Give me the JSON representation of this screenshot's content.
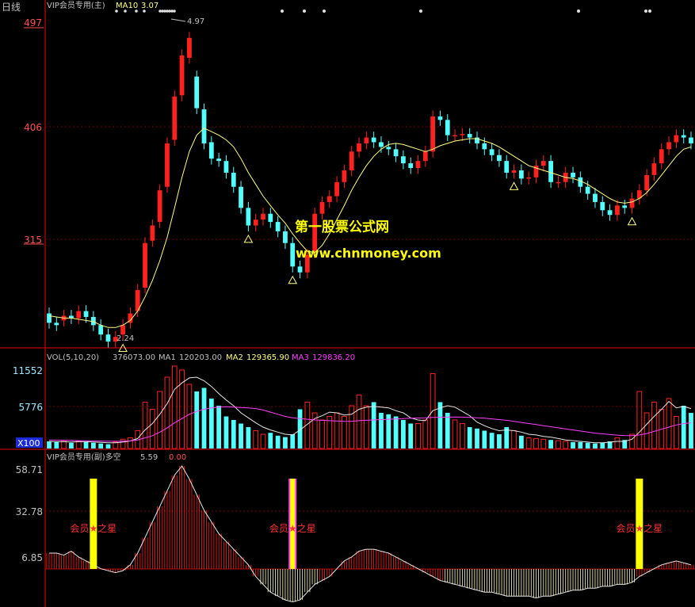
{
  "header": {
    "period": "日线",
    "indicator_main": "VIP会员专用(主)",
    "ma_label": "MA10",
    "ma_value": "3.07"
  },
  "watermark": {
    "site_name": "第一股票公式网",
    "site_url": "www.chnmoney.com"
  },
  "colors": {
    "background": "#000000",
    "frame": "#a00000",
    "up_candle": "#ff2020",
    "down_candle": "#54ffff",
    "ma_line": "#ffff80",
    "text_grey": "#c0c0c0",
    "axis_red": "#ff5050",
    "axis_cyan": "#9fe8ff",
    "magenta": "#ff40ff",
    "yellow": "#ffff00",
    "watermark_yellow": "#ffff00",
    "watermark_white": "#ffffff"
  },
  "chart_data": [
    {
      "type": "candlestick",
      "name": "price",
      "y_ticks": [
        "497",
        "406",
        "315"
      ],
      "y_tick_values": [
        4.97,
        4.06,
        3.15
      ],
      "ylim": [
        2.24,
        4.97
      ],
      "annotations": {
        "high_label": "4.97",
        "low_label": "2.24"
      },
      "grid": true,
      "closes": [
        2.42,
        2.4,
        2.48,
        2.46,
        2.52,
        2.47,
        2.4,
        2.32,
        2.26,
        2.3,
        2.4,
        2.5,
        2.7,
        3.1,
        3.25,
        3.55,
        3.95,
        4.35,
        4.7,
        4.85,
        4.25,
        3.95,
        3.82,
        3.8,
        3.7,
        3.58,
        3.4,
        3.25,
        3.3,
        3.35,
        3.28,
        3.2,
        3.1,
        2.9,
        2.85,
        3.0,
        3.35,
        3.45,
        3.5,
        3.62,
        3.72,
        3.88,
        3.95,
        4.0,
        3.96,
        3.92,
        3.9,
        3.84,
        3.78,
        3.74,
        3.8,
        3.88,
        4.18,
        4.15,
        4.02,
        4.02,
        4.03,
        4.0,
        3.95,
        3.9,
        3.85,
        3.8,
        3.7,
        3.72,
        3.65,
        3.66,
        3.76,
        3.8,
        3.62,
        3.62,
        3.7,
        3.66,
        3.58,
        3.52,
        3.45,
        3.38,
        3.34,
        3.42,
        3.4,
        3.48,
        3.55,
        3.68,
        3.78,
        3.9,
        3.96,
        4.02,
        4.0,
        3.95
      ],
      "opens": [
        2.5,
        2.42,
        2.44,
        2.48,
        2.46,
        2.52,
        2.47,
        2.4,
        2.32,
        2.26,
        2.32,
        2.42,
        2.52,
        2.72,
        3.12,
        3.28,
        3.58,
        3.98,
        4.36,
        4.68,
        4.52,
        4.24,
        3.96,
        3.82,
        3.8,
        3.7,
        3.58,
        3.4,
        3.25,
        3.3,
        3.35,
        3.28,
        3.2,
        3.1,
        2.9,
        2.85,
        3.02,
        3.35,
        3.45,
        3.5,
        3.62,
        3.72,
        3.88,
        3.95,
        4.0,
        3.96,
        3.92,
        3.9,
        3.84,
        3.78,
        3.74,
        3.8,
        3.88,
        4.18,
        4.15,
        4.02,
        4.02,
        4.03,
        4.0,
        3.95,
        3.9,
        3.85,
        3.8,
        3.7,
        3.72,
        3.65,
        3.66,
        3.76,
        3.8,
        3.62,
        3.62,
        3.7,
        3.66,
        3.58,
        3.52,
        3.45,
        3.38,
        3.34,
        3.42,
        3.4,
        3.48,
        3.55,
        3.68,
        3.78,
        3.9,
        3.96,
        4.02,
        4.0
      ],
      "ma10": [
        2.48,
        2.47,
        2.46,
        2.46,
        2.45,
        2.44,
        2.43,
        2.4,
        2.38,
        2.38,
        2.4,
        2.44,
        2.52,
        2.64,
        2.78,
        2.95,
        3.15,
        3.4,
        3.66,
        3.88,
        4.02,
        4.08,
        4.05,
        4.02,
        3.98,
        3.92,
        3.82,
        3.7,
        3.6,
        3.5,
        3.42,
        3.34,
        3.27,
        3.18,
        3.1,
        3.03,
        3.02,
        3.08,
        3.18,
        3.3,
        3.42,
        3.55,
        3.66,
        3.76,
        3.84,
        3.9,
        3.94,
        3.95,
        3.94,
        3.92,
        3.9,
        3.88,
        3.9,
        3.93,
        3.95,
        3.97,
        3.98,
        3.99,
        3.99,
        3.97,
        3.95,
        3.92,
        3.88,
        3.84,
        3.8,
        3.76,
        3.74,
        3.72,
        3.7,
        3.68,
        3.66,
        3.65,
        3.63,
        3.6,
        3.56,
        3.52,
        3.48,
        3.45,
        3.44,
        3.45,
        3.48,
        3.53,
        3.6,
        3.68,
        3.76,
        3.84,
        3.9,
        3.92
      ],
      "signal_marks": [
        10,
        27,
        33,
        63,
        79
      ]
    },
    {
      "type": "bar",
      "name": "volume",
      "header": "VOL(5,10,20)",
      "vol_value": "376073.00",
      "ma1_label": "MA1",
      "ma1_value": "120203.00",
      "ma2_label": "MA2",
      "ma2_value": "129365.90",
      "ma3_label": "MA3",
      "ma3_value": "129836.20",
      "y_ticks": [
        "11552",
        "5776"
      ],
      "y_tick_values": [
        11552,
        5776
      ],
      "unit_label": "X100",
      "ylim": [
        0,
        11552
      ],
      "values": [
        1000,
        900,
        1100,
        800,
        1000,
        900,
        800,
        700,
        600,
        900,
        1300,
        1500,
        2500,
        6500,
        5500,
        8000,
        10000,
        11552,
        11000,
        9000,
        8000,
        8500,
        7000,
        6000,
        4500,
        4000,
        3500,
        3000,
        2500,
        2000,
        2200,
        1800,
        1600,
        2000,
        5500,
        6500,
        5000,
        4000,
        4500,
        5000,
        4500,
        6000,
        7500,
        6000,
        6500,
        5000,
        4800,
        4500,
        4000,
        3500,
        3500,
        4000,
        10500,
        6500,
        5000,
        4000,
        3500,
        3000,
        2800,
        2500,
        2200,
        2000,
        3000,
        2500,
        1800,
        1500,
        1400,
        1300,
        1200,
        1100,
        1000,
        900,
        900,
        800,
        700,
        800,
        1000,
        1500,
        1200,
        2000,
        8000,
        5000,
        6500,
        5500,
        7000,
        4500,
        6000,
        5000
      ],
      "ma1": [
        1000,
        950,
        950,
        900,
        950,
        950,
        900,
        850,
        800,
        800,
        900,
        1050,
        1400,
        2600,
        3500,
        4800,
        6300,
        8300,
        9200,
        9900,
        10000,
        9500,
        8700,
        7700,
        6800,
        6000,
        5000,
        4300,
        3600,
        3000,
        2600,
        2300,
        2000,
        1900,
        2600,
        3400,
        4200,
        4600,
        5100,
        5000,
        4700,
        4800,
        5500,
        5800,
        5900,
        5800,
        5700,
        5300,
        5000,
        4300,
        4000,
        3900,
        5300,
        5700,
        6000,
        5800,
        5200,
        4600,
        3700,
        3200,
        2800,
        2500,
        2600,
        2500,
        2300,
        2000,
        1900,
        1700,
        1600,
        1400,
        1200,
        1100,
        1000,
        900,
        800,
        800,
        900,
        1000,
        1000,
        1300,
        2300,
        3400,
        4500,
        5500,
        6600,
        5700,
        5900,
        5600
      ],
      "ma3": [
        1200,
        1180,
        1150,
        1130,
        1100,
        1080,
        1060,
        1040,
        1020,
        1010,
        1030,
        1080,
        1200,
        1500,
        1800,
        2300,
        2900,
        3600,
        4200,
        4800,
        5200,
        5500,
        5700,
        5800,
        5850,
        5800,
        5750,
        5700,
        5600,
        5400,
        5100,
        4800,
        4500,
        4300,
        4200,
        4100,
        4000,
        3950,
        3900,
        3850,
        3800,
        3820,
        3900,
        3950,
        4000,
        4050,
        4100,
        4150,
        4200,
        4250,
        4280,
        4300,
        4350,
        4380,
        4400,
        4420,
        4400,
        4350,
        4300,
        4250,
        4150,
        4050,
        3950,
        3800,
        3650,
        3500,
        3350,
        3200,
        3050,
        2900,
        2750,
        2600,
        2450,
        2300,
        2150,
        2050,
        1950,
        1880,
        1820,
        1800,
        1900,
        2100,
        2400,
        2700,
        3000,
        3300,
        3500,
        3600
      ]
    },
    {
      "type": "area",
      "name": "long-short",
      "header": "VIP会员专用(副)多空",
      "value": "5.59",
      "value2": "0.00",
      "y_ticks": [
        "58.71",
        "32.78",
        "6.85"
      ],
      "y_tick_values": [
        58.71,
        32.78,
        6.85
      ],
      "ylim": [
        -12,
        58.71
      ],
      "star_label": "会员★之星",
      "star_positions": [
        6,
        33,
        80
      ],
      "values": [
        14,
        14,
        13,
        15,
        12,
        10,
        8,
        6,
        5,
        4,
        5,
        8,
        14,
        22,
        30,
        38,
        46,
        54,
        58.71,
        52,
        44,
        36,
        30,
        24,
        20,
        16,
        12,
        8,
        2,
        -2,
        -6,
        -8,
        -10,
        -11,
        -10,
        -6,
        -2,
        0,
        2,
        6,
        10,
        12,
        15,
        16,
        16,
        15,
        14,
        12,
        10,
        8,
        6,
        4,
        2,
        0,
        -1,
        -2,
        -3,
        -4,
        -5,
        -6,
        -6,
        -7,
        -8,
        -8,
        -8,
        -8,
        -9,
        -8,
        -8,
        -7,
        -6,
        -5,
        -5,
        -4,
        -4,
        -3,
        -3,
        -2,
        -2,
        -1,
        2,
        4,
        6,
        8,
        9,
        10,
        9,
        8
      ]
    }
  ]
}
